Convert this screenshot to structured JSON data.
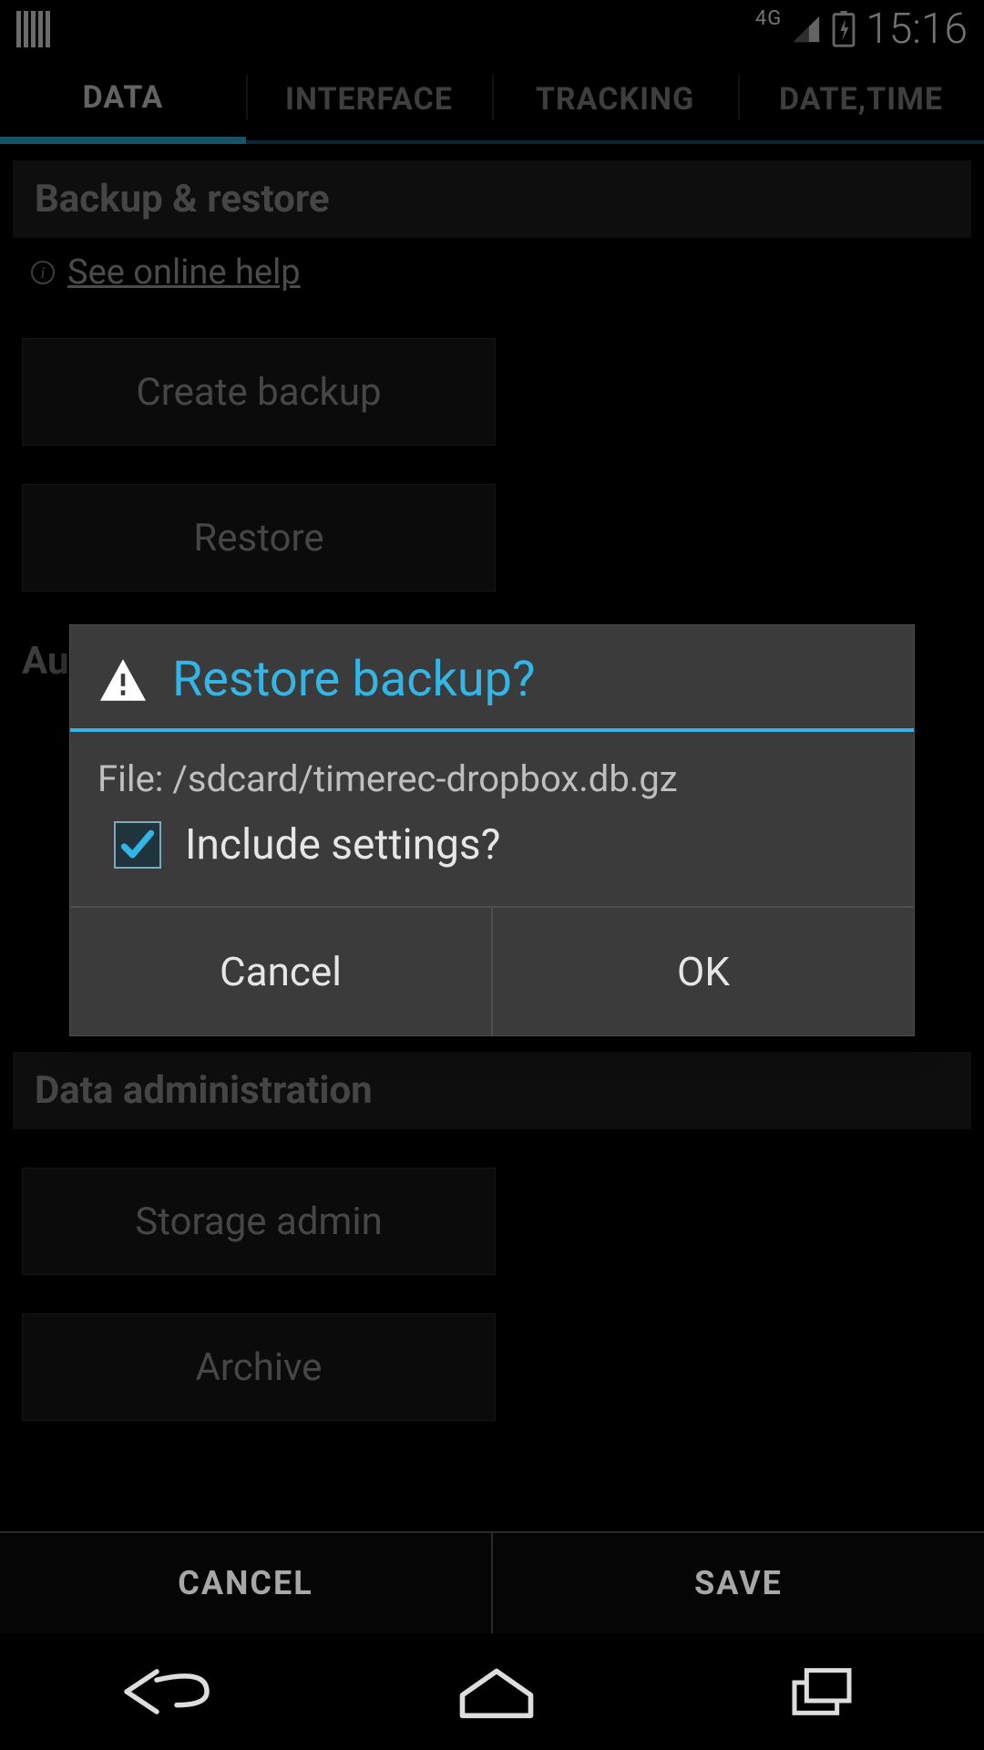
{
  "statusbar": {
    "network_label": "4G",
    "clock": "15:16"
  },
  "tabs": [
    {
      "label": "DATA",
      "active": true
    },
    {
      "label": "INTERFACE",
      "active": false
    },
    {
      "label": "TRACKING",
      "active": false
    },
    {
      "label": "DATE,TIME",
      "active": false
    }
  ],
  "sections": {
    "backup_restore_header": "Backup & restore",
    "help_link": "See online help",
    "create_backup_btn": "Create backup",
    "restore_btn": "Restore",
    "autobackup_partial": "Au",
    "data_admin_header": "Data administration",
    "storage_admin_btn": "Storage admin",
    "archive_btn": "Archive"
  },
  "footer": {
    "cancel": "CANCEL",
    "save": "SAVE"
  },
  "dialog": {
    "title": "Restore backup?",
    "file_label": "File: /sdcard/timerec-dropbox.db.gz",
    "include_settings_label": "Include settings?",
    "include_settings_checked": true,
    "cancel": "Cancel",
    "ok": "OK"
  },
  "icons": {
    "app": "barcode-icon",
    "signal": "signal-icon",
    "battery": "battery-charging-icon",
    "warning": "warning-icon",
    "info": "info-icon",
    "nav_back": "back-icon",
    "nav_home": "home-icon",
    "nav_recent": "recent-apps-icon"
  }
}
